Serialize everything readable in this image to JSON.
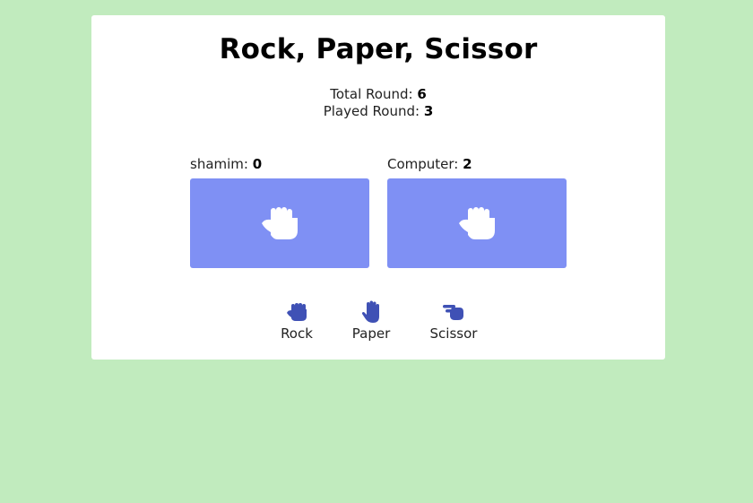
{
  "game": {
    "title": "Rock, Paper, Scissor",
    "total_round_label": "Total Round:",
    "total_round_value": "6",
    "played_round_label": "Played Round:",
    "played_round_value": "3"
  },
  "players": {
    "user": {
      "name": "shamim:",
      "score": "0",
      "choice_icon": "rock-fist-icon"
    },
    "computer": {
      "name": "Computer:",
      "score": "2",
      "choice_icon": "rock-fist-icon"
    }
  },
  "options": [
    {
      "label": "Rock",
      "icon": "rock-icon"
    },
    {
      "label": "Paper",
      "icon": "paper-icon"
    },
    {
      "label": "Scissor",
      "icon": "scissor-icon"
    }
  ],
  "colors": {
    "background": "#c1ebbe",
    "card": "#ffffff",
    "choice_box": "#7f90f4",
    "option_icon": "#3f51b5"
  }
}
